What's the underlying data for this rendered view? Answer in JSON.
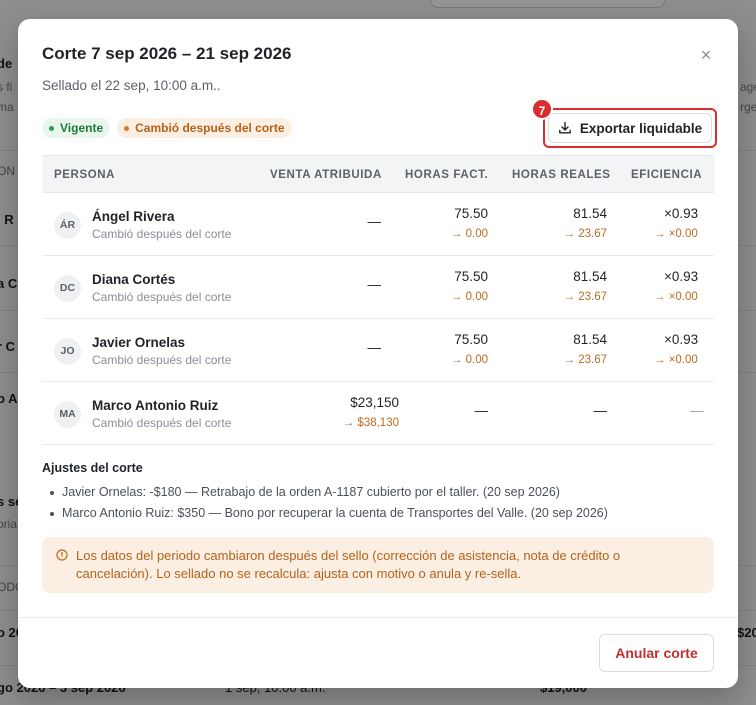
{
  "background": {
    "fragments": [
      "de",
      "s fi",
      "ma",
      "ON",
      "l R",
      "a C",
      "r C",
      "o A",
      "s se",
      "oria",
      "ODO",
      "o 20",
      "go 2026 – 3 sep 2026",
      "1 sep, 10:00 a.m.",
      "$19,000",
      "ages",
      "rger",
      "$20"
    ]
  },
  "modal": {
    "title": "Corte 7 sep 2026 – 21 sep 2026",
    "subtitle": "Sellado el 22 sep, 10:00 a.m..",
    "close_glyph": "×",
    "badges": [
      {
        "label": "Vigente",
        "tone": "green"
      },
      {
        "label": "Cambió después del corte",
        "tone": "orange"
      }
    ],
    "export": {
      "label": "Exportar liquidable",
      "step": "7"
    },
    "table": {
      "headers": [
        "PERSONA",
        "VENTA ATRIBUIDA",
        "HORAS FACT.",
        "HORAS REALES",
        "EFICIENCIA"
      ],
      "rows": [
        {
          "initials": "ÁR",
          "name": "Ángel Rivera",
          "note": "Cambió después del corte",
          "venta": "—",
          "venta_delta": "",
          "hfact": "75.50",
          "hfact_delta": "→ 0.00",
          "hreal": "81.54",
          "hreal_delta": "→ 23.67",
          "efic": "×0.93",
          "efic_delta": "→ ×0.00"
        },
        {
          "initials": "DC",
          "name": "Diana Cortés",
          "note": "Cambió después del corte",
          "venta": "—",
          "venta_delta": "",
          "hfact": "75.50",
          "hfact_delta": "→ 0.00",
          "hreal": "81.54",
          "hreal_delta": "→ 23.67",
          "efic": "×0.93",
          "efic_delta": "→ ×0.00"
        },
        {
          "initials": "JO",
          "name": "Javier Ornelas",
          "note": "Cambió después del corte",
          "venta": "—",
          "venta_delta": "",
          "hfact": "75.50",
          "hfact_delta": "→ 0.00",
          "hreal": "81.54",
          "hreal_delta": "→ 23.67",
          "efic": "×0.93",
          "efic_delta": "→ ×0.00"
        },
        {
          "initials": "MA",
          "name": "Marco Antonio Ruiz",
          "note": "Cambió después del corte",
          "venta": "$23,150",
          "venta_delta": "→ $38,130",
          "hfact": "—",
          "hfact_delta": "",
          "hreal": "—",
          "hreal_delta": "",
          "efic": "—",
          "efic_delta": ""
        }
      ]
    },
    "adjustments": {
      "title": "Ajustes del corte",
      "items": [
        "Javier Ornelas: -$180 — Retrabajo de la orden A-1187 cubierto por el taller. (20 sep 2026)",
        "Marco Antonio Ruiz: $350 — Bono por recuperar la cuenta de Transportes del Valle. (20 sep 2026)"
      ]
    },
    "alert": {
      "text": "Los datos del periodo cambiaron después del sello (corrección de asistencia, nota de crédito o cancelación). Lo sellado no se recalcula: ajusta con motivo o anula y re-sella.",
      "icon": "info-circle-icon"
    },
    "footer": {
      "annul_label": "Anular corte"
    },
    "colors": {
      "accent_red": "#d72f2f",
      "warning_orange": "#b5621a",
      "success_green": "#1d7a3c"
    }
  }
}
